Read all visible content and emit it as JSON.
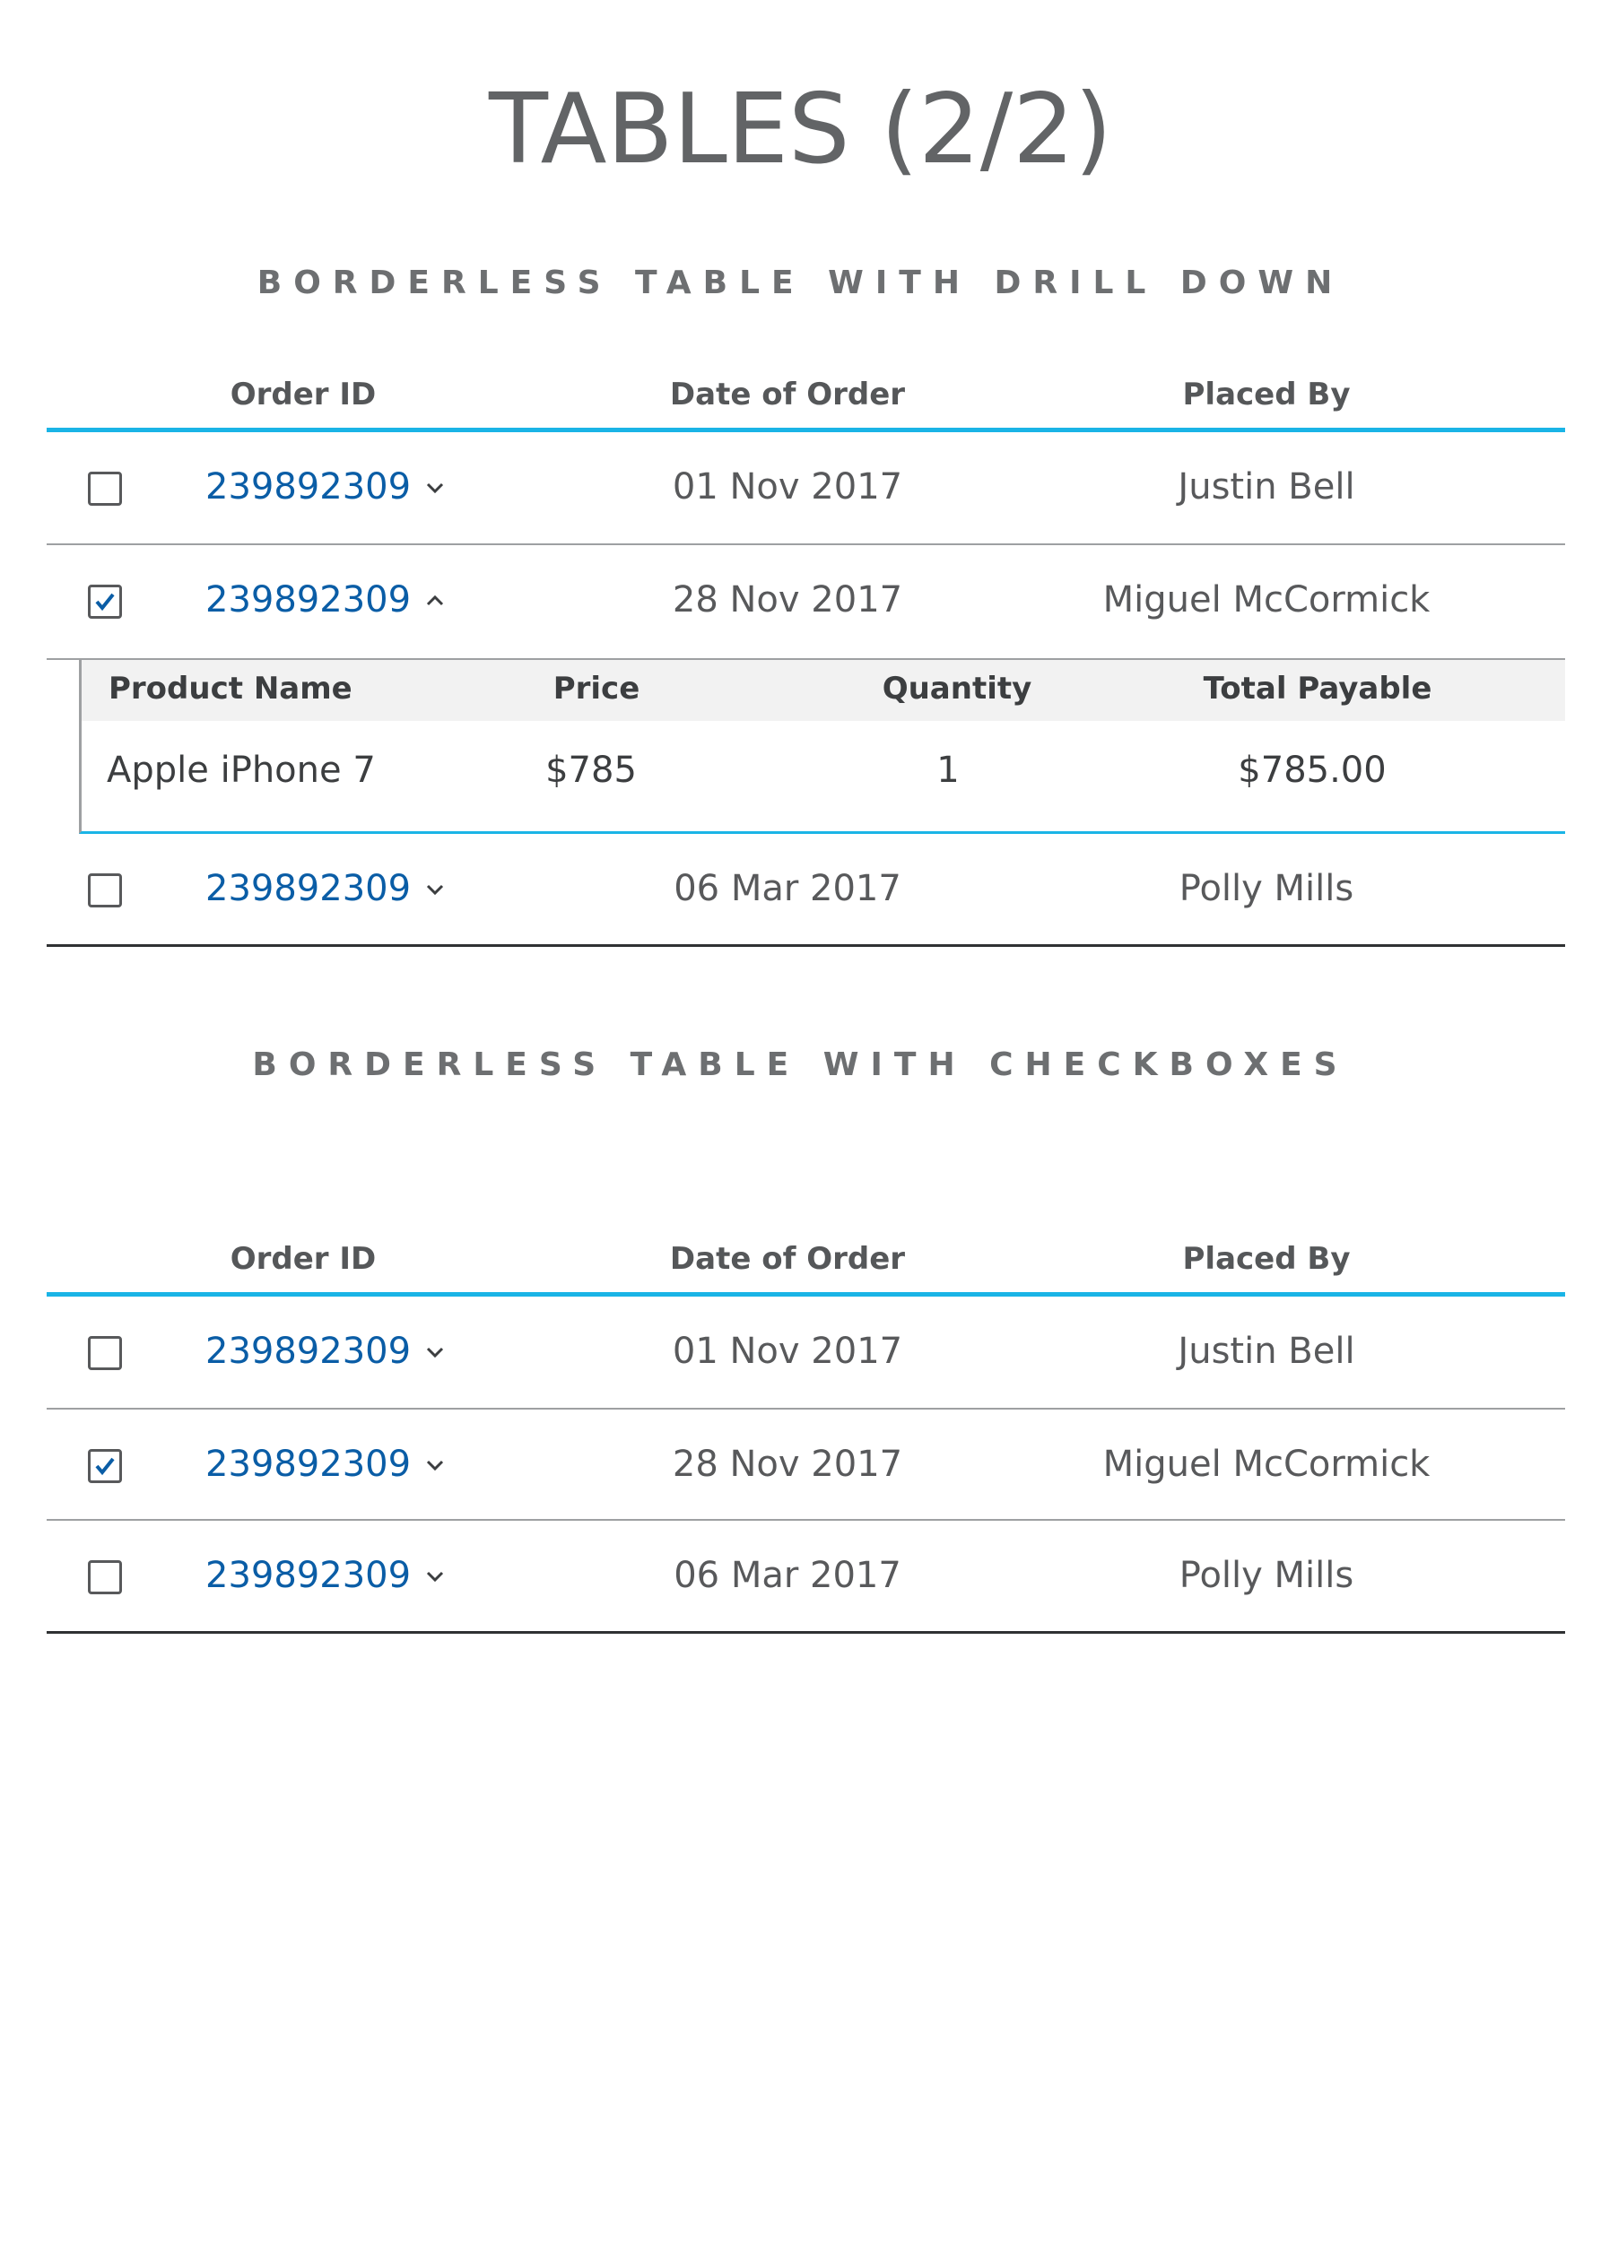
{
  "page": {
    "title": "TABLES (2/2)"
  },
  "drill_table": {
    "section_title": "BORDERLESS TABLE WITH DRILL DOWN",
    "headers": {
      "order_id": "Order ID",
      "date": "Date of Order",
      "placed_by": "Placed By"
    },
    "rows": [
      {
        "checked": false,
        "order_id": "239892309",
        "expanded": false,
        "date": "01 Nov 2017",
        "placed_by": "Justin Bell"
      },
      {
        "checked": true,
        "order_id": "239892309",
        "expanded": true,
        "date": "28 Nov 2017",
        "placed_by": "Miguel McCormick"
      },
      {
        "checked": false,
        "order_id": "239892309",
        "expanded": false,
        "date": "06 Mar 2017",
        "placed_by": "Polly Mills"
      }
    ],
    "detail": {
      "headers": {
        "product": "Product Name",
        "price": "Price",
        "quantity": "Quantity",
        "total": "Total Payable"
      },
      "rows": [
        {
          "product": "Apple iPhone 7",
          "price": "$785",
          "quantity": "1",
          "total": "$785.00"
        }
      ]
    }
  },
  "checkbox_table": {
    "section_title": "BORDERLESS TABLE WITH CHECKBOXES",
    "headers": {
      "order_id": "Order ID",
      "date": "Date of Order",
      "placed_by": "Placed By"
    },
    "rows": [
      {
        "checked": false,
        "order_id": "239892309",
        "date": "01 Nov 2017",
        "placed_by": "Justin Bell"
      },
      {
        "checked": true,
        "order_id": "239892309",
        "date": "28 Nov 2017",
        "placed_by": "Miguel McCormick"
      },
      {
        "checked": false,
        "order_id": "239892309",
        "date": "06 Mar 2017",
        "placed_by": "Polly Mills"
      }
    ]
  },
  "colors": {
    "accent": "#1ab4e6",
    "link": "#0a5da6",
    "text": "#58595b"
  }
}
